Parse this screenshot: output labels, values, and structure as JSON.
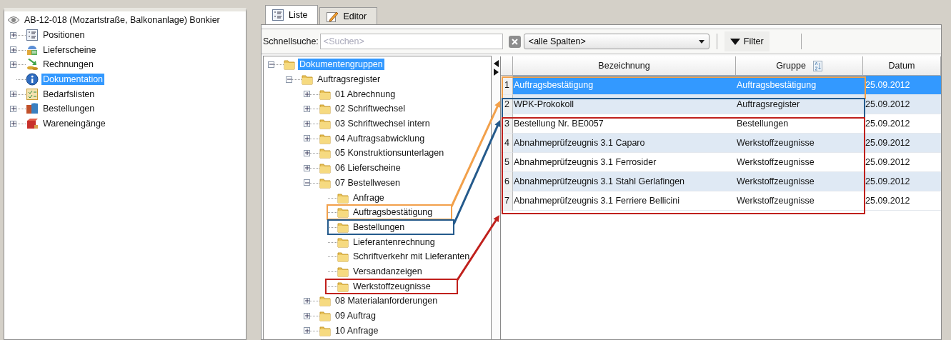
{
  "project_tree": {
    "root": {
      "label": "AB-12-018 (Mozartstraße, Balkonanlage) Bonkier"
    },
    "items": [
      {
        "label": "Positionen",
        "kind": "list",
        "expanded": false,
        "selected": false
      },
      {
        "label": "Lieferscheine",
        "kind": "delivery",
        "expanded": false,
        "selected": false
      },
      {
        "label": "Rechnungen",
        "kind": "invoice",
        "expanded": false,
        "selected": false
      },
      {
        "label": "Dokumentation",
        "kind": "info",
        "selected": true
      },
      {
        "label": "Bedarfslisten",
        "kind": "checklist",
        "expanded": false,
        "selected": false
      },
      {
        "label": "Bestellungen",
        "kind": "boxes",
        "expanded": false,
        "selected": false
      },
      {
        "label": "Wareneingänge",
        "kind": "parcel",
        "expanded": false,
        "selected": false
      }
    ]
  },
  "tabs": [
    {
      "label": "Liste",
      "kind": "list",
      "selected": true
    },
    {
      "label": "Editor",
      "kind": "pencil",
      "selected": false
    }
  ],
  "toolbar": {
    "search_label": "Schnellsuche:",
    "search": {
      "placeholder": "<Suchen>"
    },
    "column_select": "<alle Spalten>",
    "filter_button": "Filter"
  },
  "group_tree": [
    {
      "label": "Dokumentengruppen",
      "expanded": true,
      "selected": true,
      "children": [
        {
          "label": "Auftragsregister",
          "expanded": true,
          "selected": false,
          "children": [
            {
              "label": "01 Abrechnung",
              "expanded": false,
              "selected": false
            },
            {
              "label": "02 Schriftwechsel",
              "expanded": false,
              "selected": false
            },
            {
              "label": "03 Schriftwechsel intern",
              "expanded": false,
              "selected": false
            },
            {
              "label": "04 Auftragsabwicklung",
              "expanded": false,
              "selected": false
            },
            {
              "label": "05 Konstruktionsunterlagen",
              "expanded": false,
              "selected": false
            },
            {
              "label": "06 Lieferscheine",
              "expanded": false,
              "selected": false
            },
            {
              "label": "07 Bestellwesen",
              "expanded": true,
              "selected": false,
              "children": [
                {
                  "label": "Anfrage",
                  "selected": false
                },
                {
                  "label": "Auftragsbestätigung",
                  "selected": false
                },
                {
                  "label": "Bestellungen",
                  "selected": false
                },
                {
                  "label": "Lieferantenrechnung",
                  "selected": false
                },
                {
                  "label": "Schriftverkehr mit Lieferanten",
                  "selected": false
                },
                {
                  "label": "Versandanzeigen",
                  "selected": false
                },
                {
                  "label": "Werkstoffzeugnisse",
                  "selected": false
                }
              ]
            },
            {
              "label": "08 Materialanforderungen",
              "expanded": false,
              "selected": false
            },
            {
              "label": "09 Auftrag",
              "expanded": false,
              "selected": false
            },
            {
              "label": "10 Anfrage",
              "expanded": false,
              "selected": false
            }
          ]
        }
      ]
    }
  ],
  "table": {
    "columns": [
      "Bezeichnung",
      "Gruppe",
      "Datum"
    ],
    "rows": [
      {
        "number": "1",
        "cells": [
          "Auftragsbestätigung",
          "Auftragsbestätigung",
          "25.09.2012"
        ],
        "selected": true
      },
      {
        "number": "2",
        "cells": [
          "WPK-Prokokoll",
          "Auftragsregister",
          "25.09.2012"
        ],
        "selected": false
      },
      {
        "number": "3",
        "cells": [
          "Bestellung Nr. BE0057",
          "Bestellungen",
          "25.09.2012"
        ],
        "selected": false
      },
      {
        "number": "4",
        "cells": [
          "Abnahmeprüfzeugnis 3.1 Caparo",
          "Werkstoffzeugnisse",
          "25.09.2012"
        ],
        "selected": false
      },
      {
        "number": "5",
        "cells": [
          "Abnahmeprüfzeugnis 3.1 Ferrosider",
          "Werkstoffzeugnisse",
          "25.09.2012"
        ],
        "selected": false
      },
      {
        "number": "6",
        "cells": [
          "Abnahmeprüfzeugnis 3.1 Stahl Gerlafingen",
          "Werkstoffzeugnisse",
          "25.09.2012"
        ],
        "selected": false
      },
      {
        "number": "7",
        "cells": [
          "Abnahmeprüfzeugnis 3.1 Ferriere Bellicini",
          "Werkstoffzeugnisse",
          "25.09.2012"
        ],
        "selected": false
      }
    ]
  },
  "annotations": [
    {
      "color": "#f2a04a"
    },
    {
      "color": "#245a8c"
    },
    {
      "color": "#c0201c"
    }
  ]
}
